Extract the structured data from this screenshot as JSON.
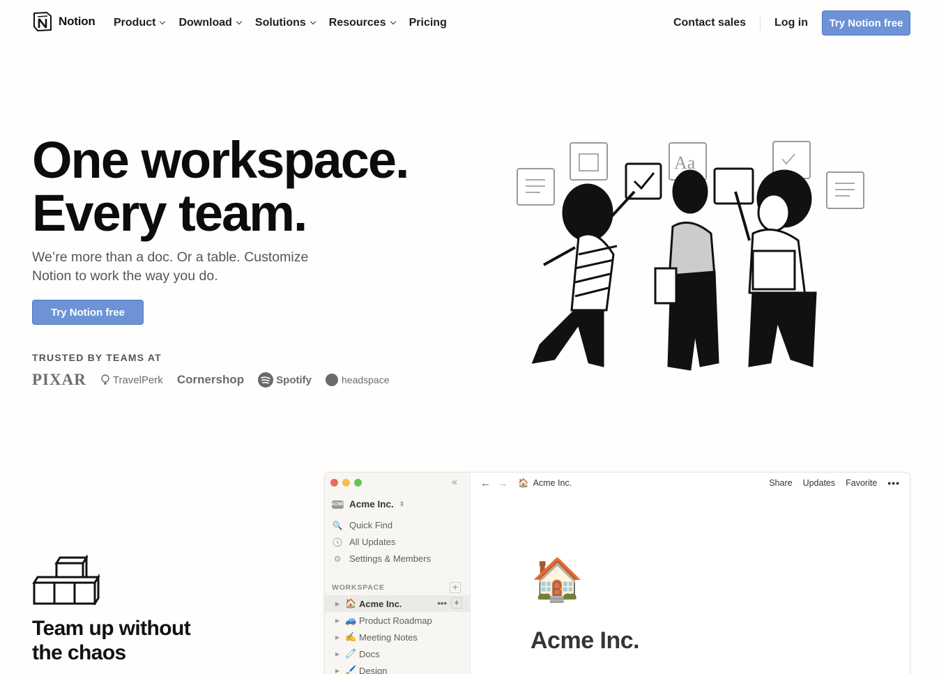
{
  "nav": {
    "brand": "Notion",
    "menu": [
      {
        "label": "Product",
        "dropdown": true
      },
      {
        "label": "Download",
        "dropdown": true
      },
      {
        "label": "Solutions",
        "dropdown": true
      },
      {
        "label": "Resources",
        "dropdown": true
      },
      {
        "label": "Pricing",
        "dropdown": false
      }
    ],
    "contact_sales": "Contact sales",
    "log_in": "Log in",
    "cta": "Try Notion free"
  },
  "hero": {
    "title_line1": "One workspace.",
    "title_line2": "Every team.",
    "subtitle": "We’re more than a doc. Or a table. Customize Notion to work the way you do.",
    "cta": "Try Notion free",
    "trusted_label": "TRUSTED BY TEAMS AT",
    "logos": [
      "PIXAR",
      "TravelPerk",
      "Cornershop",
      "Spotify",
      "headspace"
    ]
  },
  "feature": {
    "title": "Team up without the chaos"
  },
  "app": {
    "workspace_name": "Acme Inc.",
    "workspace_badge": "ACME",
    "sidebar_items": [
      {
        "icon": "search-icon",
        "glyph": "🔍",
        "label": "Quick Find"
      },
      {
        "icon": "clock-icon",
        "glyph": "🕓",
        "label": "All Updates"
      },
      {
        "icon": "gear-icon",
        "glyph": "⚙",
        "label": "Settings & Members"
      }
    ],
    "workspace_section": "WORKSPACE",
    "pages": [
      {
        "emoji": "🏠",
        "label": "Acme Inc.",
        "active": true
      },
      {
        "emoji": "🚙",
        "label": "Product Roadmap",
        "active": false
      },
      {
        "emoji": "✍️",
        "label": "Meeting Notes",
        "active": false
      },
      {
        "emoji": "🧷",
        "label": "Docs",
        "active": false
      },
      {
        "emoji": "🖌️",
        "label": "Design",
        "active": false
      }
    ],
    "breadcrumb_emoji": "🏠",
    "breadcrumb": "Acme Inc.",
    "actions": [
      "Share",
      "Updates",
      "Favorite"
    ],
    "more": "•••",
    "page_emoji": "🏠",
    "page_title": "Acme Inc."
  },
  "colors": {
    "accent": "#6d93d6",
    "background": "#fffefc",
    "traffic_red": "#ec6a5e",
    "traffic_yellow": "#f4bf4f",
    "traffic_green": "#61c554"
  }
}
